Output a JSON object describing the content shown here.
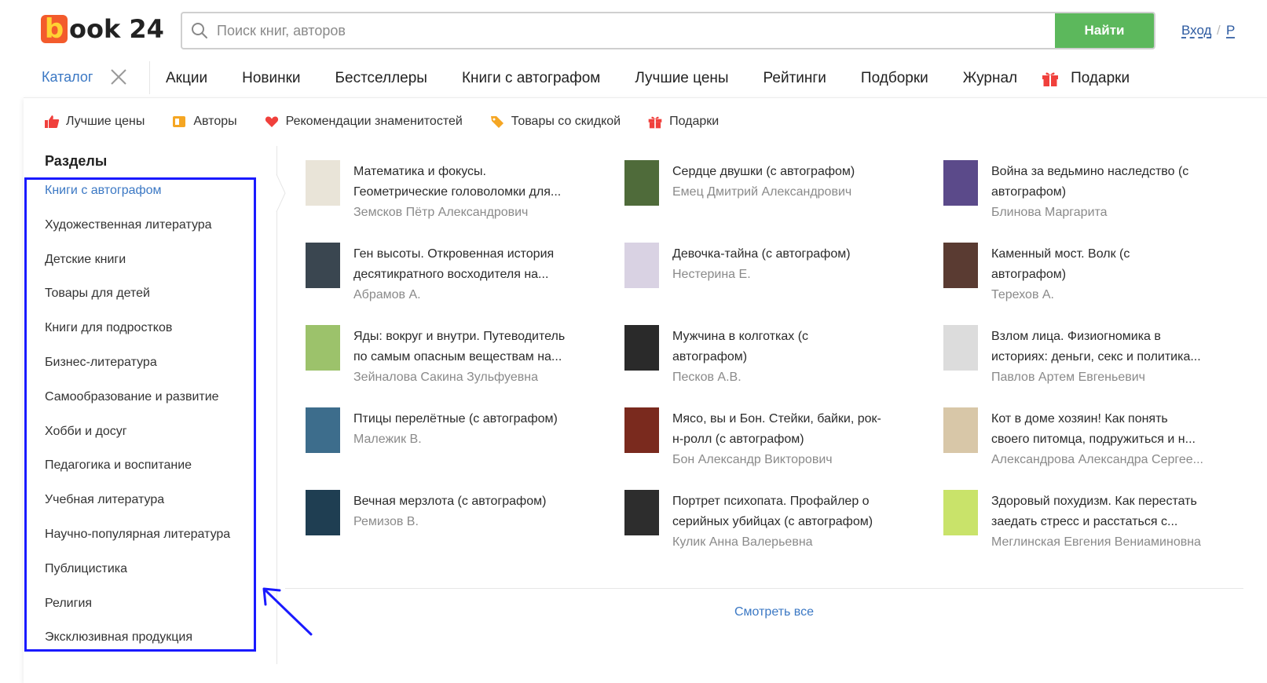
{
  "logo": {
    "letter": "b",
    "text": "ook 24"
  },
  "search": {
    "placeholder": "Поиск книг, авторов",
    "button": "Найти"
  },
  "auth": {
    "login": "Вход",
    "separator": "/",
    "register": "Р"
  },
  "nav": {
    "catalog": "Каталог",
    "items": [
      "Акции",
      "Новинки",
      "Бестселлеры",
      "Книги с автографом",
      "Лучшие цены",
      "Рейтинги",
      "Подборки",
      "Журнал"
    ],
    "gifts": "Подарки"
  },
  "subnav": [
    {
      "label": "Лучшие цены",
      "icon": "thumbs-up-icon",
      "color": "#f0403c"
    },
    {
      "label": "Авторы",
      "icon": "author-icon",
      "color": "#f5a623"
    },
    {
      "label": "Рекомендации знаменитостей",
      "icon": "heart-icon",
      "color": "#f0403c"
    },
    {
      "label": "Товары со скидкой",
      "icon": "tag-icon",
      "color": "#f5a623"
    },
    {
      "label": "Подарки",
      "icon": "gift-icon",
      "color": "#f0403c"
    }
  ],
  "sections": {
    "title": "Разделы",
    "items": [
      "Книги с автографом",
      "Художественная литература",
      "Детские книги",
      "Товары для детей",
      "Книги для подростков",
      "Бизнес-литература",
      "Самообразование и развитие",
      "Хобби и досуг",
      "Педагогика и воспитание",
      "Учебная литература",
      "Научно-популярная литература",
      "Публицистика",
      "Религия",
      "Эксклюзивная продукция"
    ]
  },
  "books": [
    {
      "lines": [
        "Математика и фокусы.",
        "Геометрические головоломки для..."
      ],
      "author": "Земсков Пётр Александрович",
      "cover": "#e9e4d8"
    },
    {
      "lines": [
        "Сердце двушки (с автографом)"
      ],
      "author": "Емец Дмитрий Александрович",
      "cover": "#4f6b3a"
    },
    {
      "lines": [
        "Война за ведьмино наследство (с",
        "автографом)"
      ],
      "author": "Блинова Маргарита",
      "cover": "#5b4a8a"
    },
    {
      "lines": [
        "Ген высоты. Откровенная история",
        "десятикратного восходителя на..."
      ],
      "author": "Абрамов А.",
      "cover": "#3a4650"
    },
    {
      "lines": [
        "Девочка-тайна (с автографом)"
      ],
      "author": "Нестерина Е.",
      "cover": "#d9d2e3"
    },
    {
      "lines": [
        "Каменный мост. Волк (с",
        "автографом)"
      ],
      "author": "Терехов А.",
      "cover": "#5a3b32"
    },
    {
      "lines": [
        "Яды: вокруг и внутри. Путеводитель",
        "по самым опасным веществам на..."
      ],
      "author": "Зейналова Сакина Зульфуевна",
      "cover": "#9cc26b"
    },
    {
      "lines": [
        "Мужчина в колготках (с",
        "автографом)"
      ],
      "author": "Песков А.В.",
      "cover": "#2a2a2a"
    },
    {
      "lines": [
        "Взлом лица. Физиогномика в",
        "историях: деньги, секс и политика..."
      ],
      "author": "Павлов Артем Евгеньевич",
      "cover": "#dcdcdc"
    },
    {
      "lines": [
        "Птицы перелётные (с автографом)"
      ],
      "author": "Малежик В.",
      "cover": "#3d6d8c"
    },
    {
      "lines": [
        "Мясо, вы и Бон. Стейки, байки, рок-",
        "н-ролл (с автографом)"
      ],
      "author": "Бон Александр Викторович",
      "cover": "#7a2a1e"
    },
    {
      "lines": [
        "Кот в доме хозяин! Как понять",
        "своего питомца, подружиться и н..."
      ],
      "author": "Александрова Александра Сергее...",
      "cover": "#d8c7a8"
    },
    {
      "lines": [
        "Вечная мерзлота (с автографом)"
      ],
      "author": "Ремизов В.",
      "cover": "#1f3e52"
    },
    {
      "lines": [
        "Портрет психопата. Профайлер о",
        "серийных убийцах (с автографом)"
      ],
      "author": "Кулик Анна Валерьевна",
      "cover": "#2d2d2d"
    },
    {
      "lines": [
        "Здоровый похудизм. Как перестать",
        "заедать стресс и расстаться с..."
      ],
      "author": "Меглинская Евгения Вениаминовна",
      "cover": "#c9e36a"
    }
  ],
  "see_all": "Смотреть все",
  "colors": {
    "accent": "#3b78c4",
    "brand": "#f35b2c",
    "button": "#5cb85c",
    "highlight": "#1a1aff"
  }
}
